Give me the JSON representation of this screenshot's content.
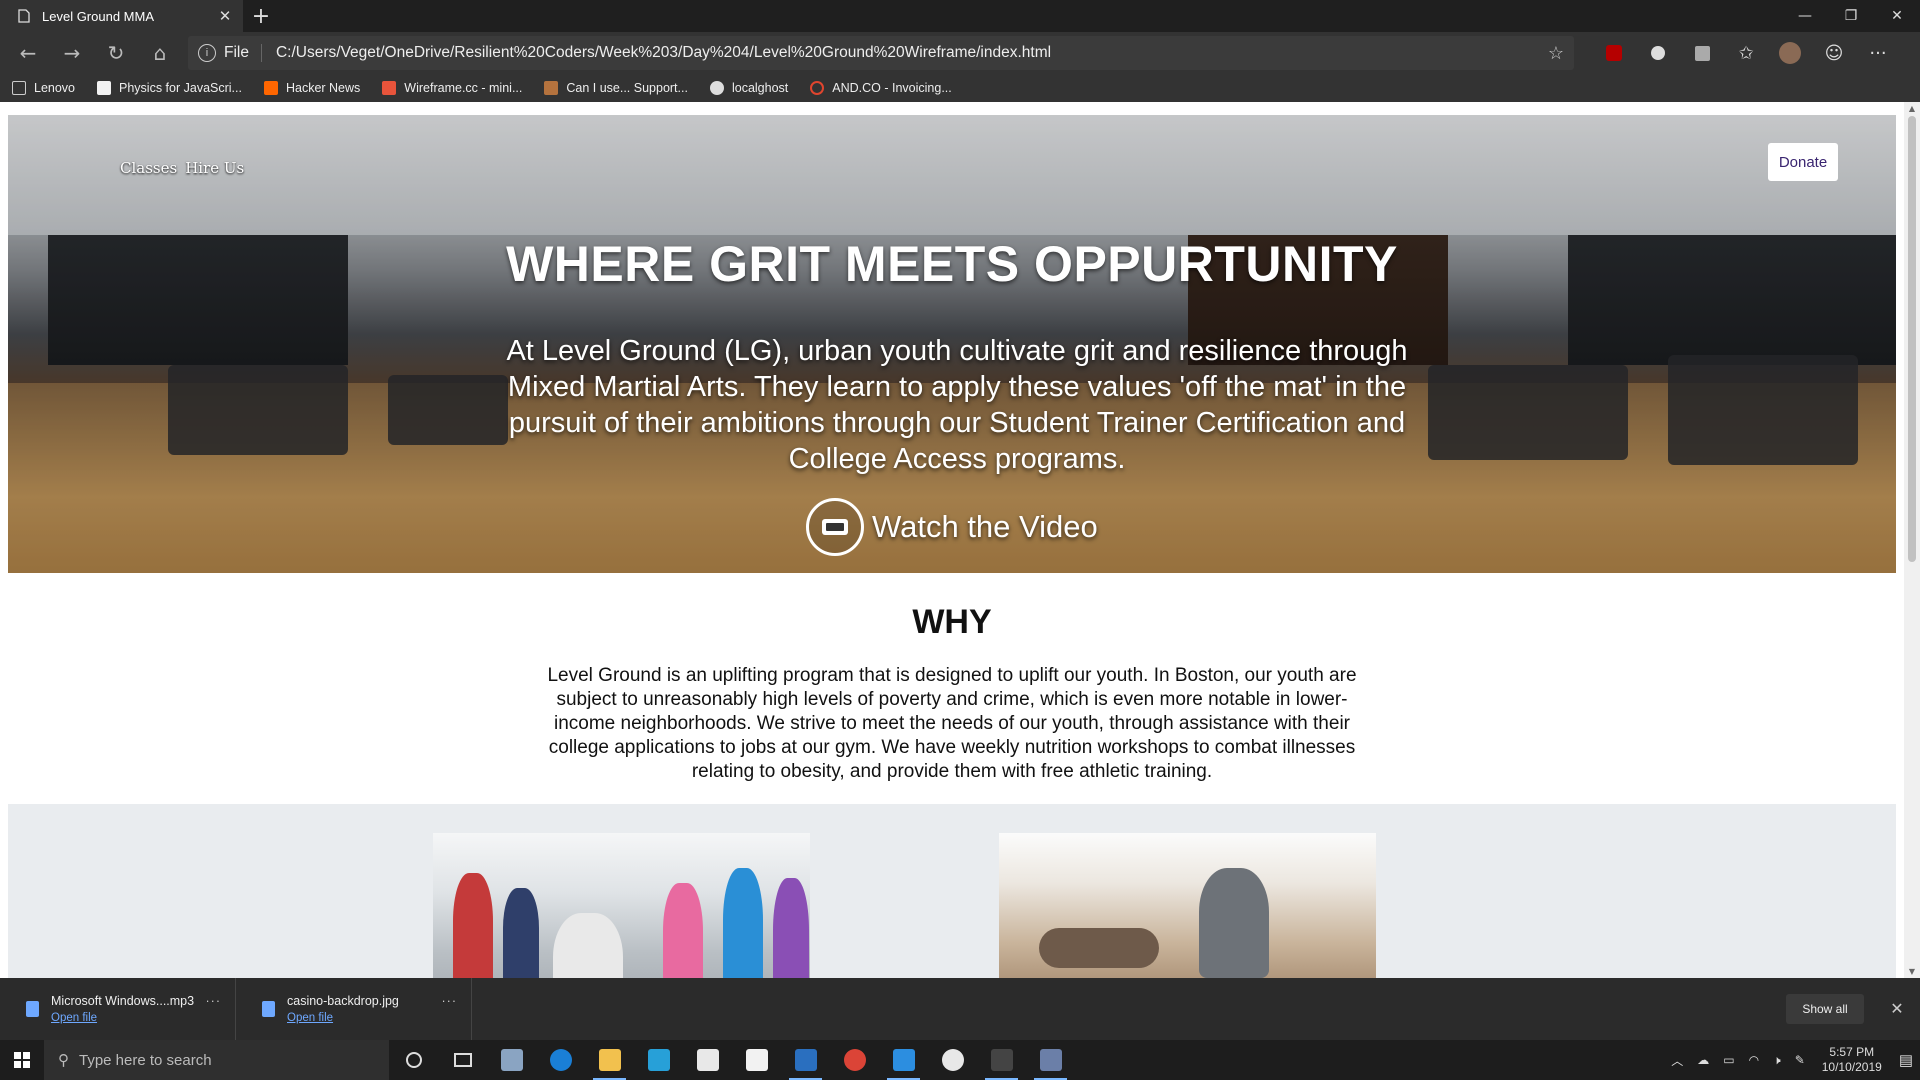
{
  "browser": {
    "tab_title": "Level Ground MMA",
    "tab_close": "✕",
    "new_tab": "+",
    "scheme": "File",
    "url": "C:/Users/Veget/OneDrive/Resilient%20Coders/Week%203/Day%204/Level%20Ground%20Wireframe/index.html",
    "bookmarks": [
      {
        "label": "Lenovo",
        "color": "#cccccc"
      },
      {
        "label": "Physics for JavaScri...",
        "color": "#f2f2f2"
      },
      {
        "label": "Hacker News",
        "color": "#ff6600"
      },
      {
        "label": "Wireframe.cc - mini...",
        "color": "#e8543b"
      },
      {
        "label": "Can I use... Support...",
        "color": "#b5733e"
      },
      {
        "label": "localghost",
        "color": "#dddddd"
      },
      {
        "label": "AND.CO - Invoicing...",
        "color": "#e0452e"
      }
    ]
  },
  "site": {
    "nav": {
      "classes": "Classes",
      "hire": "Hire Us"
    },
    "donate": "Donate",
    "hero_title": "WHERE GRIT MEETS OPPURTUNITY",
    "hero_text": "At Level Ground (LG), urban youth cultivate grit and resilience through Mixed Martial Arts. They learn to apply these values 'off the mat' in the pursuit of their ambitions through our Student Trainer Certification and College Access programs.",
    "watch_video": "Watch the Video",
    "why_title": "WHY",
    "why_text": "Level Ground is an uplifting program that is designed to uplift our youth. In Boston, our youth are subject to unreasonably high levels of poverty and crime, which is even more notable in lower-income neighborhoods. We strive to meet the needs of our youth, through assistance with their college applications to jobs at our gym. We have weekly nutrition workshops to combat illnesses relating to obesity, and provide them with free athletic training."
  },
  "downloads": {
    "items": [
      {
        "name": "Microsoft Windows....mp3",
        "action": "Open file"
      },
      {
        "name": "casino-backdrop.jpg",
        "action": "Open file"
      }
    ],
    "more": "···",
    "show_all": "Show all",
    "close": "✕"
  },
  "taskbar": {
    "search_placeholder": "Type here to search",
    "time": "5:57 PM",
    "date": "10/10/2019"
  },
  "colors": {
    "accent": "#3a2570",
    "link": "#6ea8ff"
  }
}
